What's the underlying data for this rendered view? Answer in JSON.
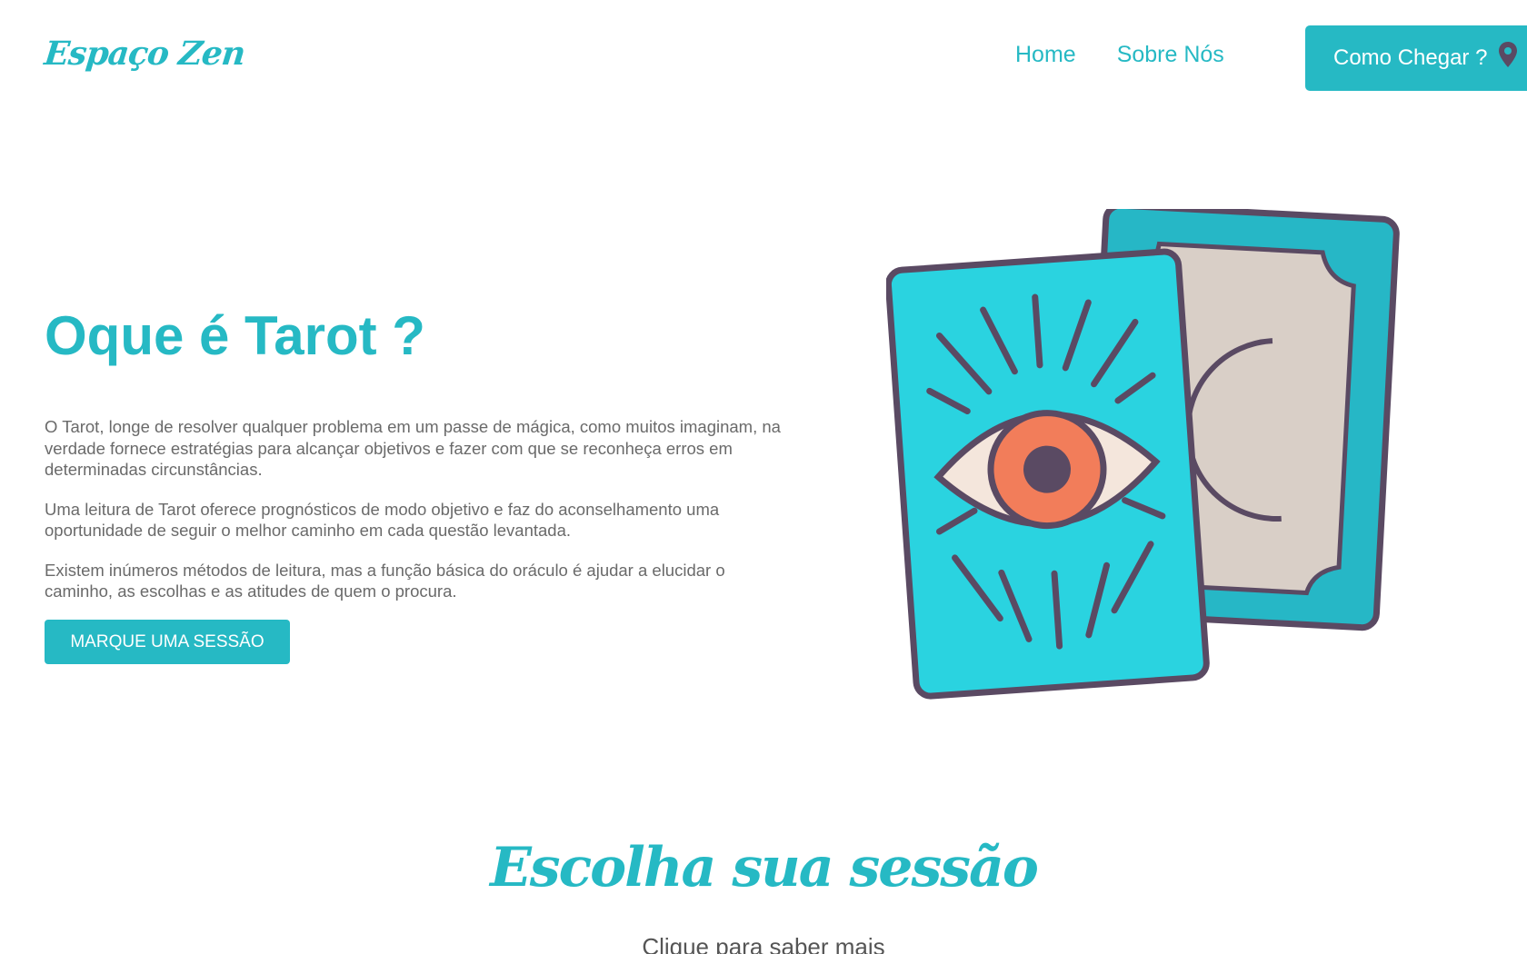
{
  "header": {
    "logo": "Espaço Zen",
    "nav": [
      "Home",
      "Sobre Nós"
    ],
    "cta_label": "Como Chegar ?",
    "cta_icon": "map-pin-icon"
  },
  "hero": {
    "title": "Oque é Tarot ?",
    "paragraphs": [
      "O Tarot, longe de resolver qualquer problema em um passe de mágica, como muitos imaginam, na verdade fornece estratégias para alcançar objetivos e fazer com que se reconheça erros em determinadas circunstâncias.",
      "Uma leitura de Tarot oferece prognósticos de modo objetivo e faz do aconselhamento uma oportunidade de seguir o melhor caminho em cada questão levantada.",
      "Existem inúmeros métodos de leitura, mas a função básica do oráculo é ajudar a elucidar o caminho, as escolhas e as atitudes de quem o procura."
    ],
    "button_label": "MARQUE UMA SESSÃO"
  },
  "sessions": {
    "title": "Escolha sua sessão",
    "subtitle": "Clique para saber mais"
  },
  "colors": {
    "accent": "#26b9c4",
    "text": "#6a6a6a",
    "card_front": "#2ad3e0",
    "card_back": "#26b7c6",
    "outline": "#5a4a63",
    "eye": "#f27d5a",
    "moon": "#e07050",
    "paper": "#d9cfc7"
  }
}
